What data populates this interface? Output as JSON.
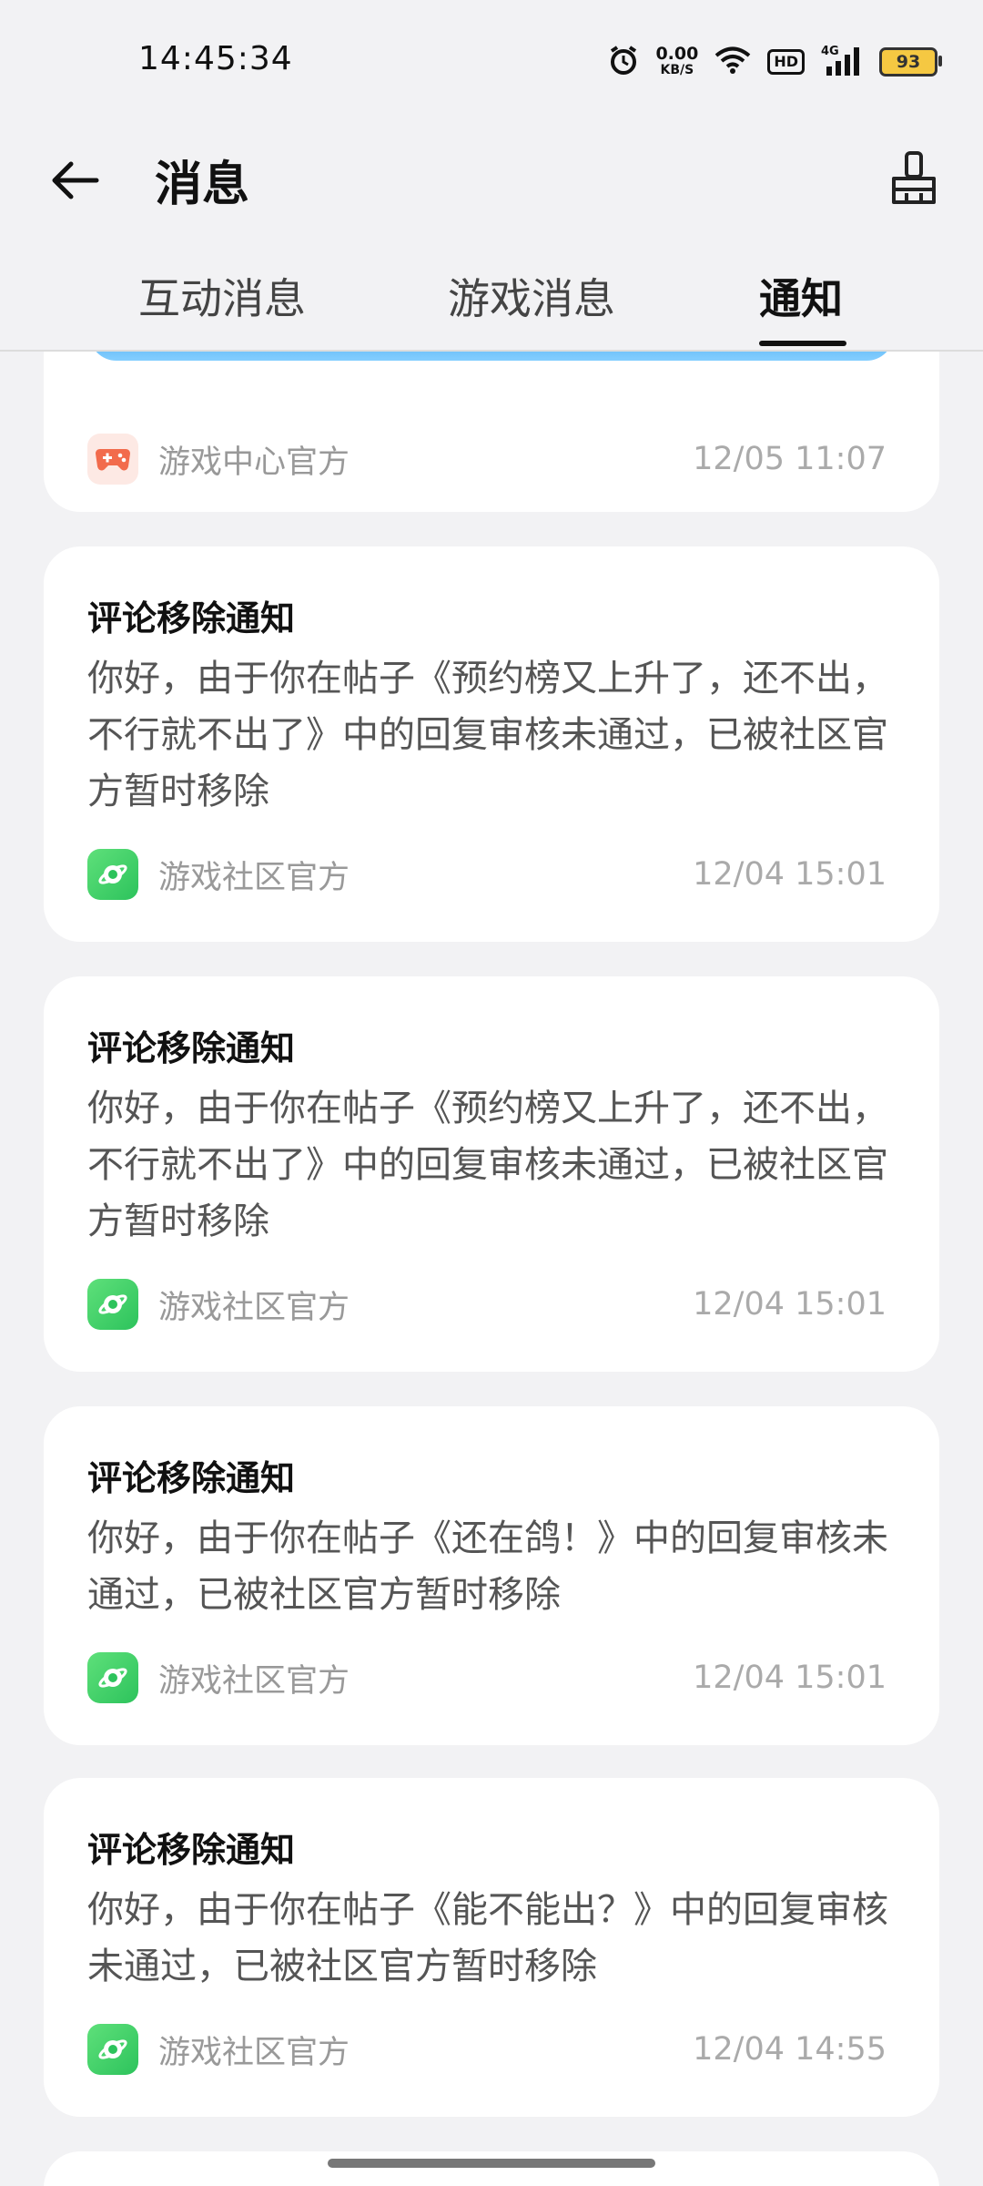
{
  "status_bar": {
    "time": "14:45:34",
    "net_speed": "0.00",
    "net_unit": "KB/S",
    "hd": "HD",
    "signal": "4G",
    "battery": "93"
  },
  "header": {
    "title": "消息"
  },
  "tabs": [
    {
      "label": "互动消息",
      "active": false
    },
    {
      "label": "游戏消息",
      "active": false
    },
    {
      "label": "通知",
      "active": true
    }
  ],
  "notifications": [
    {
      "title": "",
      "body": "",
      "source": "游戏中心官方",
      "time": "12/05 11:07",
      "icon": "gamepad-icon"
    },
    {
      "title": "评论移除通知",
      "body": "你好，由于你在帖子《预约榜又上升了，还不出，不行就不出了》中的回复审核未通过，已被社区官方暂时移除",
      "source": "游戏社区官方",
      "time": "12/04 15:01",
      "icon": "planet-icon"
    },
    {
      "title": "评论移除通知",
      "body": "你好，由于你在帖子《预约榜又上升了，还不出，不行就不出了》中的回复审核未通过，已被社区官方暂时移除",
      "source": "游戏社区官方",
      "time": "12/04 15:01",
      "icon": "planet-icon"
    },
    {
      "title": "评论移除通知",
      "body": "你好，由于你在帖子《还在鸽！》中的回复审核未通过，已被社区官方暂时移除",
      "source": "游戏社区官方",
      "time": "12/04 15:01",
      "icon": "planet-icon"
    },
    {
      "title": "评论移除通知",
      "body": "你好，由于你在帖子《能不能出？》中的回复审核未通过，已被社区官方暂时移除",
      "source": "游戏社区官方",
      "time": "12/04 14:55",
      "icon": "planet-icon"
    }
  ],
  "colors": {
    "background": "#f2f2f4",
    "card": "#ffffff",
    "community_icon": "#2dc35c",
    "game_icon": "#f26b4c"
  }
}
